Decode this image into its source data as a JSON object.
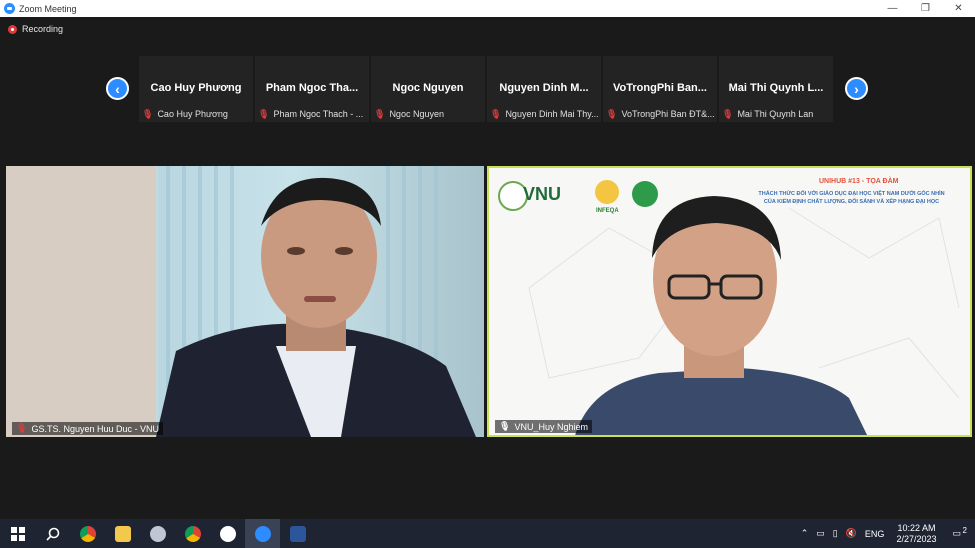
{
  "window": {
    "title": "Zoom Meeting"
  },
  "recording": {
    "label": "Recording"
  },
  "participants_strip": [
    {
      "display": "Cao Huy Phương",
      "label": "Cao Huy Phương"
    },
    {
      "display": "Pham Ngoc Tha...",
      "label": "Pham Ngoc Thach - ..."
    },
    {
      "display": "Ngoc Nguyen",
      "label": "Ngoc Nguyen"
    },
    {
      "display": "Nguyen Dinh M...",
      "label": "Nguyen Dinh Mai Thy..."
    },
    {
      "display": "VoTrongPhi Ban...",
      "label": "VoTrongPhi Ban ĐT&..."
    },
    {
      "display": "Mai Thi Quynh L...",
      "label": "Mai Thi Quynh Lan"
    }
  ],
  "videos": {
    "left": {
      "label": "GS.TS. Nguyen Huu Duc - VNU"
    },
    "right": {
      "label": "VNU_Huy Nghiem",
      "banner_title": "UNIHUB #13 - TỌA ĐÀM",
      "banner_line1": "THÁCH THỨC ĐỐI VỚI GIÁO DỤC ĐẠI HỌC VIỆT NAM DƯỚI GÓC NHÌN",
      "banner_line2": "CỦA KIỂM ĐỊNH CHẤT LƯỢNG, ĐỐI SÁNH VÀ XẾP HẠNG ĐẠI HỌC",
      "logo_vnu": "VNU",
      "logo_infeqa": "INFEQA"
    }
  },
  "taskbar": {
    "language": "ENG",
    "time": "10:22 AM",
    "date": "2/27/2023",
    "notification_count": "2"
  },
  "colors": {
    "accent": "#2d8cff",
    "active_speaker_border": "#c8e05a",
    "mic_off": "#e03a3a"
  }
}
